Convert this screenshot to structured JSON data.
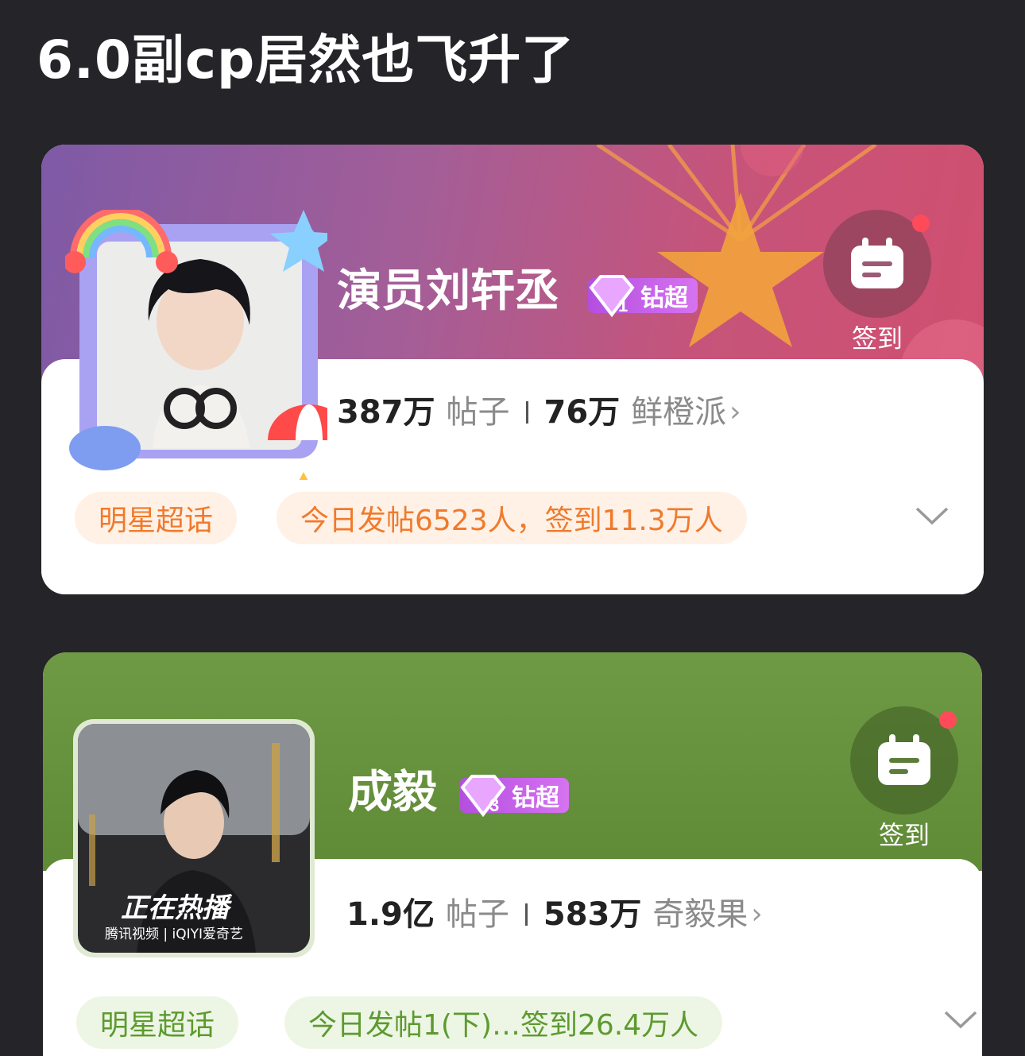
{
  "post": {
    "title": "6.0副cp居然也飞升了"
  },
  "cards": [
    {
      "name": "演员刘轩丞",
      "badge": "钻超",
      "badge_level": "1",
      "signin_label": "签到",
      "posts_count": "387万",
      "posts_label": "帖子",
      "fans_count": "76万",
      "fans_label": "鲜橙派",
      "topic_type": "明星超话",
      "daily_stats": "今日发帖6523人，签到11.3万人",
      "theme": {
        "banner": "#b05a8c",
        "pill_text": "#f07a2c",
        "pill_bg": "#fff1e6"
      }
    },
    {
      "name": "成毅",
      "badge": "钻超",
      "badge_level": "3",
      "signin_label": "签到",
      "posts_count": "1.9亿",
      "posts_label": "帖子",
      "fans_count": "583万",
      "fans_label": "奇毅果",
      "topic_type": "明星超话",
      "daily_stats": "今日发帖1(下)…签到26.4万人",
      "poster_text": "正在热播",
      "poster_logos": "腾讯视频 | iQIYI爱奇艺",
      "theme": {
        "banner": "#6a9640",
        "pill_text": "#5d9a30",
        "pill_bg": "#edf6e4"
      }
    }
  ]
}
